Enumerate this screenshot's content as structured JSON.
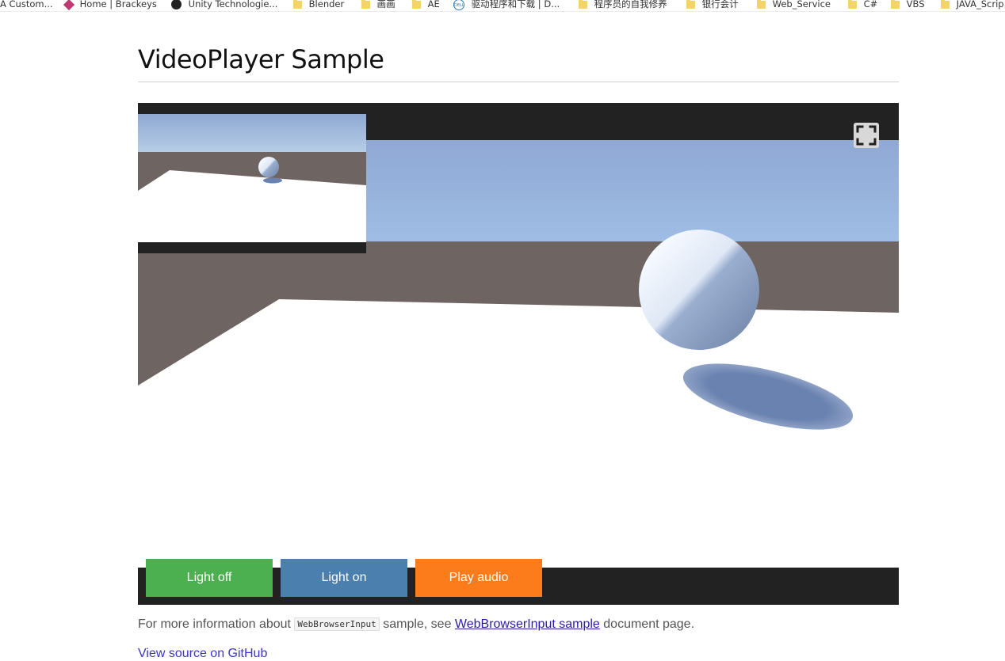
{
  "bookmarks": [
    {
      "label": "A Custom...",
      "icon": "none"
    },
    {
      "label": "Home | Brackeys",
      "icon": "brackeys-diamond-icon"
    },
    {
      "label": "Unity Technologie...",
      "icon": "github-icon"
    },
    {
      "label": "Blender",
      "icon": "folder-icon"
    },
    {
      "label": "画画",
      "icon": "folder-icon"
    },
    {
      "label": "AE",
      "icon": "folder-icon"
    },
    {
      "label": "驱动程序和下载 | D...",
      "icon": "dell-icon"
    },
    {
      "label": "程序员的自我修养",
      "icon": "folder-icon"
    },
    {
      "label": "银行会计",
      "icon": "folder-icon"
    },
    {
      "label": "Web_Service",
      "icon": "folder-icon"
    },
    {
      "label": "C#",
      "icon": "folder-icon"
    },
    {
      "label": "VBS",
      "icon": "folder-icon"
    },
    {
      "label": "JAVA_Scrip",
      "icon": "folder-icon"
    }
  ],
  "page": {
    "title": "VideoPlayer Sample"
  },
  "player": {
    "fullscreen_icon": "fullscreen-icon",
    "buttons": {
      "light_off": "Light off",
      "light_on": "Light on",
      "play_audio": "Play audio"
    },
    "colors": {
      "light_off": "#4caf50",
      "light_on": "#4a7fae",
      "play_audio": "#fc7c1c",
      "frame": "#222222"
    }
  },
  "info": {
    "prefix": "For more information about ",
    "code": "WebBrowserInput",
    "middle": " sample, see ",
    "link": "WebBrowserInput sample",
    "suffix": " document page."
  },
  "github_link": "View source on GitHub"
}
